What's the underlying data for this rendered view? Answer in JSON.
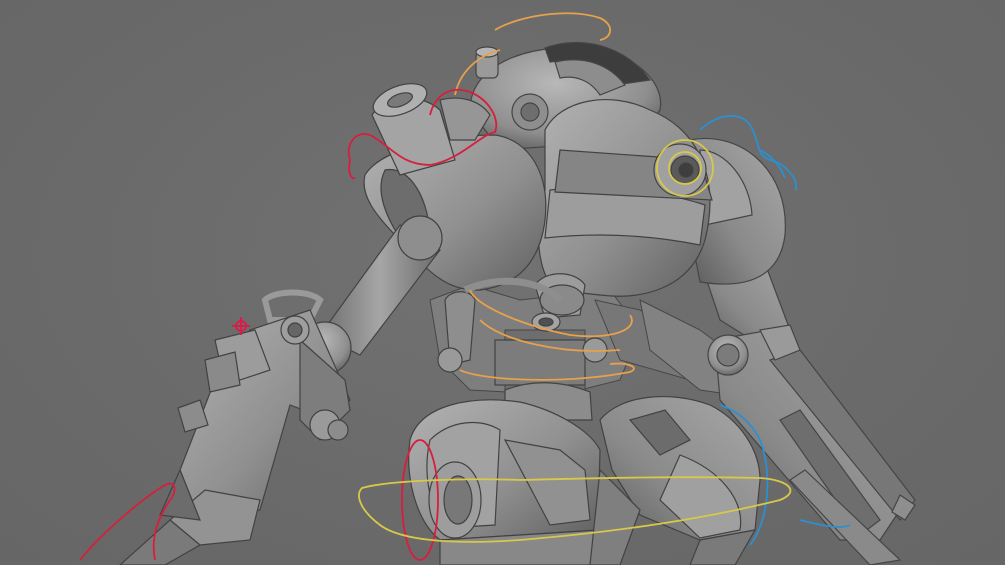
{
  "viewport": {
    "background_color": "#6b6b6b",
    "mesh_light": "#a8a8a8",
    "mesh_mid": "#8c8c8c",
    "mesh_dark": "#5e5e5e",
    "edge_color": "#3e3e3e"
  },
  "model": {
    "subject": "robot-mech-model",
    "shading": "smooth-grey"
  },
  "rig_controls": {
    "colors": {
      "orange": "#e6a14c",
      "red": "#d81e3c",
      "blue": "#2e8fd0",
      "yellow": "#d8c84a"
    },
    "ik_target_marker_color": "#e01848"
  }
}
